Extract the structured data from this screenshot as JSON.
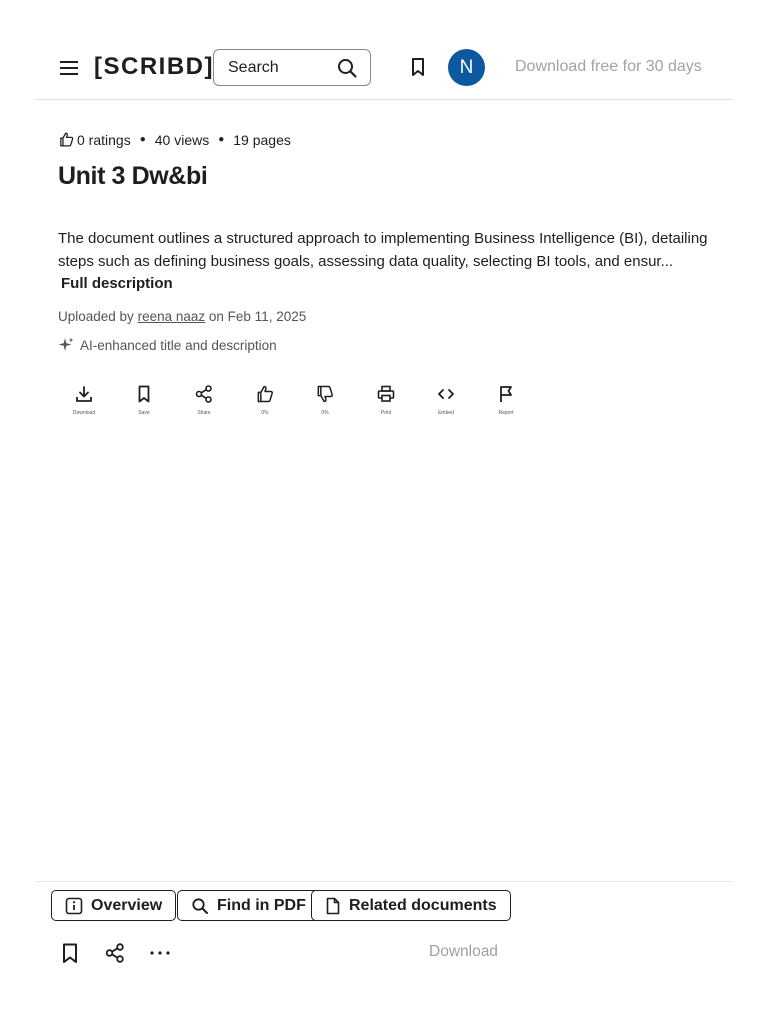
{
  "header": {
    "logo": "[SCRIBD]",
    "search_placeholder": "Search",
    "avatar_initial": "N",
    "download_free": "Download free for 30 days"
  },
  "document": {
    "ratings": "0 ratings",
    "views": "40 views",
    "pages": "19 pages",
    "title": "Unit 3 Dw&bi",
    "description": "The document outlines a structured approach to implementing Business Intelligence (BI), detailing steps such as defining business goals, assessing data quality, selecting BI tools, and ensur...",
    "full_description": "Full description",
    "uploaded_prefix": "Uploaded by",
    "uploader": "reena naaz",
    "uploaded_date": "on Feb 11, 2025",
    "ai_note": "AI-enhanced title and description"
  },
  "actions": [
    {
      "label": "Download",
      "icon": "download-icon"
    },
    {
      "label": "Save",
      "icon": "bookmark-icon"
    },
    {
      "label": "Share",
      "icon": "share-icon"
    },
    {
      "label": "0%",
      "icon": "thumbs-up-icon"
    },
    {
      "label": "0%",
      "icon": "thumbs-down-icon"
    },
    {
      "label": "Print",
      "icon": "print-icon"
    },
    {
      "label": "Embed",
      "icon": "embed-icon"
    },
    {
      "label": "Report",
      "icon": "flag-icon"
    }
  ],
  "footer": {
    "overview": "Overview",
    "find_in_pdf": "Find in PDF",
    "related_documents": "Related documents",
    "download": "Download"
  },
  "colors": {
    "avatar_bg": "#0c59a0",
    "muted_text": "#a3a3a3"
  }
}
